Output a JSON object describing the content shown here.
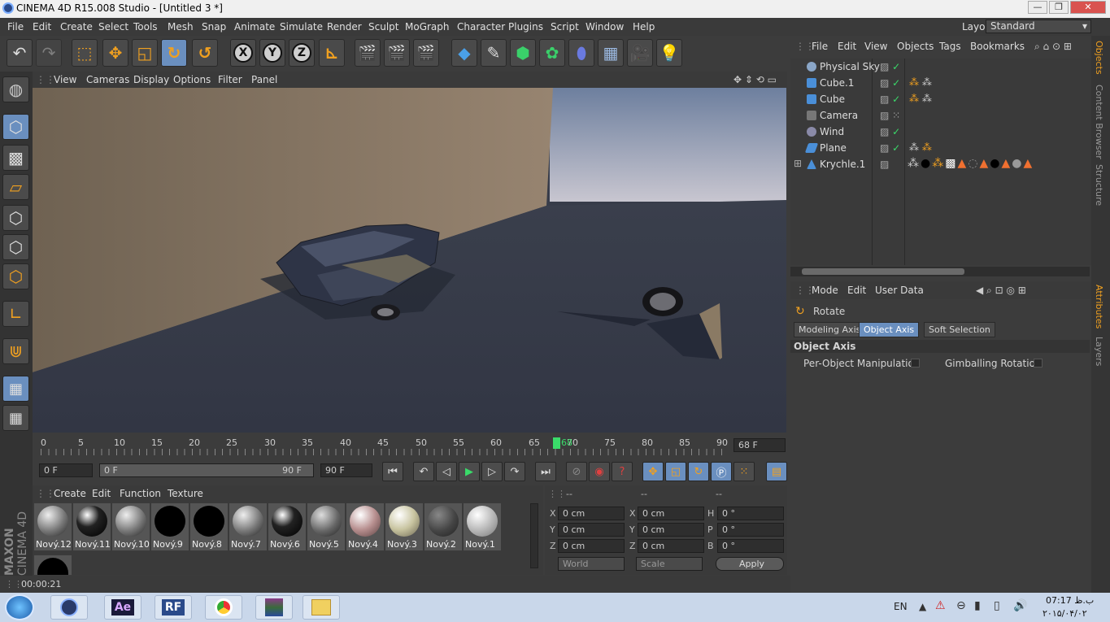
{
  "window": {
    "title": "CINEMA 4D R15.008 Studio - [Untitled 3 *]",
    "min": "—",
    "max": "❐",
    "close": "✕"
  },
  "menu": [
    "File",
    "Edit",
    "Create",
    "Select",
    "Tools",
    "Mesh",
    "Snap",
    "Animate",
    "Simulate",
    "Render",
    "Sculpt",
    "MoGraph",
    "Character",
    "Plugins",
    "Script",
    "Window",
    "Help"
  ],
  "layout": {
    "label": "Layout:",
    "value": "Standard"
  },
  "axis_buttons": [
    "X",
    "Y",
    "Z"
  ],
  "viewport_menu": [
    "View",
    "Cameras",
    "Display",
    "Options",
    "Filter",
    "Panel"
  ],
  "timeline": {
    "ticks": [
      "0",
      "5",
      "10",
      "15",
      "20",
      "25",
      "30",
      "35",
      "40",
      "45",
      "50",
      "55",
      "60",
      "65",
      "70",
      "75",
      "80",
      "85",
      "90"
    ],
    "current_frame": "68",
    "end_field": "68 F"
  },
  "playback": {
    "start": "0 F",
    "range_start": "0 F",
    "range_end": "90 F",
    "end": "90 F"
  },
  "materials": {
    "menu": [
      "Create",
      "Edit",
      "Function",
      "Texture"
    ],
    "items": [
      {
        "name": "Nový.12",
        "style": "gray"
      },
      {
        "name": "Nový.11",
        "style": "black"
      },
      {
        "name": "Nový.10",
        "style": "gray"
      },
      {
        "name": "Nový.9",
        "style": "solid"
      },
      {
        "name": "Nový.8",
        "style": "solid"
      },
      {
        "name": "Nový.7",
        "style": "gray"
      },
      {
        "name": "Nový.6",
        "style": "black"
      },
      {
        "name": "Nový.5",
        "style": "gray"
      },
      {
        "name": "Nový.4",
        "style": "pink"
      },
      {
        "name": "Nový.3",
        "style": "cream"
      },
      {
        "name": "Nový.2",
        "style": "dark"
      },
      {
        "name": "Nový.1",
        "style": "light"
      }
    ]
  },
  "coords": {
    "headers": [
      "--",
      "--",
      "--"
    ],
    "rows": [
      {
        "a": "X",
        "av": "0 cm",
        "b": "X",
        "bv": "0 cm",
        "c": "H",
        "cv": "0 °"
      },
      {
        "a": "Y",
        "av": "0 cm",
        "b": "Y",
        "bv": "0 cm",
        "c": "P",
        "cv": "0 °"
      },
      {
        "a": "Z",
        "av": "0 cm",
        "b": "Z",
        "bv": "0 cm",
        "c": "B",
        "cv": "0 °"
      }
    ],
    "world": "World",
    "scale": "Scale",
    "apply": "Apply"
  },
  "status": "00:00:21",
  "objects": {
    "menu": [
      "File",
      "Edit",
      "View",
      "Objects",
      "Tags",
      "Bookmarks"
    ],
    "items": [
      {
        "name": "Physical Sky",
        "color": "#8aa6c8"
      },
      {
        "name": "Cube.1",
        "color": "#4a8fd8"
      },
      {
        "name": "Cube",
        "color": "#4a8fd8"
      },
      {
        "name": "Camera",
        "color": "#777777"
      },
      {
        "name": "Wind",
        "color": "#8a8aa8"
      },
      {
        "name": "Plane",
        "color": "#4a8fd8"
      },
      {
        "name": "Krychle.1",
        "color": "#4a8fd8"
      }
    ]
  },
  "attributes": {
    "menu": [
      "Mode",
      "Edit",
      "User Data"
    ],
    "tool": "Rotate",
    "tabs": [
      "Modeling Axis",
      "Object Axis",
      "Soft Selection"
    ],
    "section": "Object Axis",
    "options": [
      "Per-Object Manipulation",
      "Gimballing Rotation"
    ]
  },
  "side_tabs": [
    "Objects",
    "Content Browser",
    "Structure",
    "Attributes",
    "Layers"
  ],
  "taskbar": {
    "apps": [
      "Ae",
      "RF"
    ],
    "lang": "EN",
    "time": "07:17 ب.ظ",
    "date": "۲۰۱۵/۰۴/۰۲"
  },
  "brand": {
    "line1": "MAXON",
    "line2": "CINEMA 4D"
  },
  "colors": {
    "accent": "#f0a020",
    "selection": "#6a8fbf",
    "frame_marker": "#3adb6a"
  }
}
